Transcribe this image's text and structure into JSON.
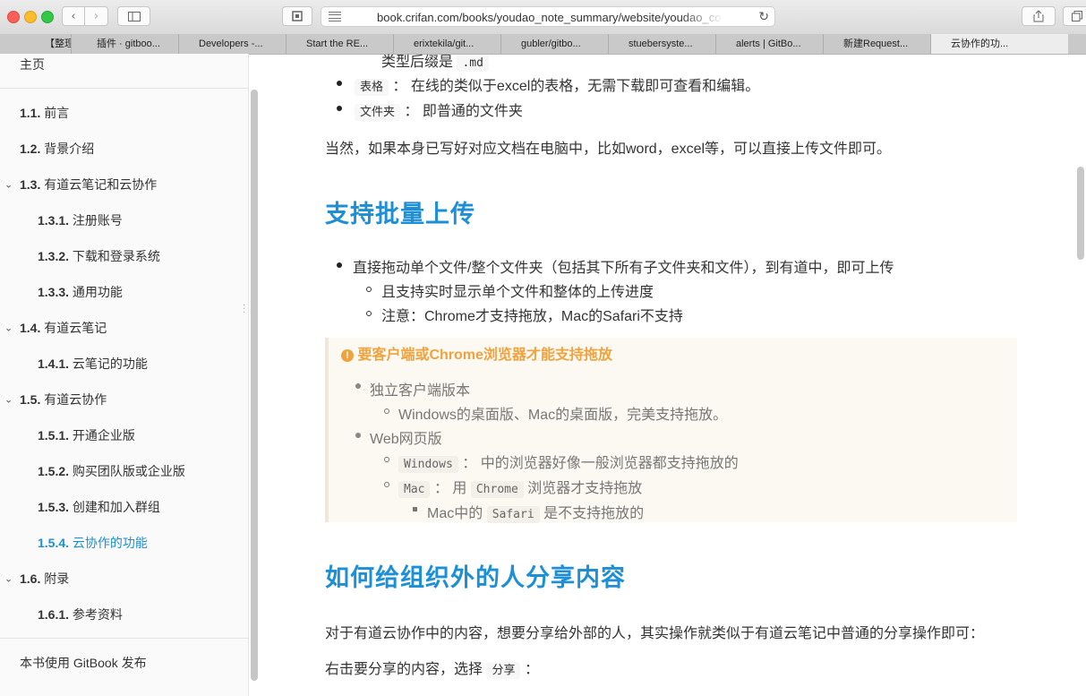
{
  "browser": {
    "url": "book.crifan.com/books/youdao_note_summary/website/youdao_coo",
    "tabs": [
      {
        "label": "【整理】S"
      },
      {
        "label": "插件 · gitboo..."
      },
      {
        "label": "Developers -..."
      },
      {
        "label": "Start the RE..."
      },
      {
        "label": "erixtekila/git..."
      },
      {
        "label": "gubler/gitbo..."
      },
      {
        "label": "stuebersyste..."
      },
      {
        "label": "alerts | GitBo..."
      },
      {
        "label": "新建Request..."
      },
      {
        "label": "云协作的功..."
      }
    ]
  },
  "sidebar": {
    "home": "主页",
    "items": [
      {
        "num": "1.1.",
        "label": "前言"
      },
      {
        "num": "1.2.",
        "label": "背景介绍"
      },
      {
        "num": "1.3.",
        "label": "有道云笔记和云协作"
      },
      {
        "num": "1.3.1.",
        "label": "注册账号"
      },
      {
        "num": "1.3.2.",
        "label": "下载和登录系统"
      },
      {
        "num": "1.3.3.",
        "label": "通用功能"
      },
      {
        "num": "1.4.",
        "label": "有道云笔记"
      },
      {
        "num": "1.4.1.",
        "label": "云笔记的功能"
      },
      {
        "num": "1.5.",
        "label": "有道云协作"
      },
      {
        "num": "1.5.1.",
        "label": "开通企业版"
      },
      {
        "num": "1.5.2.",
        "label": "购买团队版或企业版"
      },
      {
        "num": "1.5.3.",
        "label": "创建和加入群组"
      },
      {
        "num": "1.5.4.",
        "label": "云协作的功能"
      },
      {
        "num": "1.6.",
        "label": "附录"
      },
      {
        "num": "1.6.1.",
        "label": "参考资料"
      }
    ],
    "footer": "本书使用 GitBook 发布"
  },
  "content": {
    "top_line": {
      "text": "类型后缀是",
      "code": ".md"
    },
    "bullet_table": {
      "code": "表格",
      "text": "：  在线的类似于excel的表格，无需下载即可查看和编辑。"
    },
    "bullet_folder": {
      "code": "文件夹",
      "text": "：  即普通的文件夹"
    },
    "para1": "当然，如果本身已写好对应文档在电脑中，比如word，excel等，可以直接上传文件即可。",
    "h2_upload": "支持批量上传",
    "upload_bullet": "直接拖动单个文件/整个文件夹（包括其下所有子文件夹和文件），到有道中，即可上传",
    "upload_sub1": "且支持实时显示单个文件和整体的上传进度",
    "upload_sub2": "注意：Chrome才支持拖放，Mac的Safari不支持",
    "callout": {
      "icon": "!",
      "title": "要客户端或Chrome浏览器才能支持拖放",
      "b1": "独立客户端版本",
      "b1_sub": "Windows的桌面版、Mac的桌面版，完美支持拖放。",
      "b2": "Web网页版",
      "b2_sub1_code": "Windows",
      "b2_sub1_text": "：  中的浏览器好像一般浏览器都支持拖放的",
      "b2_sub2_code": "Mac",
      "b2_sub2_text1": "：  用",
      "b2_sub2_code2": "Chrome",
      "b2_sub2_text2": "浏览器才支持拖放",
      "b2_sub2_sub_text1": "Mac中的",
      "b2_sub2_sub_code": "Safari",
      "b2_sub2_sub_text2": "是不支持拖放的"
    },
    "h2_share": "如何给组织外的人分享内容",
    "para2": "对于有道云协作中的内容，想要分享给外部的人，其实操作就类似于有道云笔记中普通的分享操作即可：",
    "para3": "右击要分享的内容，选择",
    "para3_code": "分享",
    "para3_tail": "："
  }
}
